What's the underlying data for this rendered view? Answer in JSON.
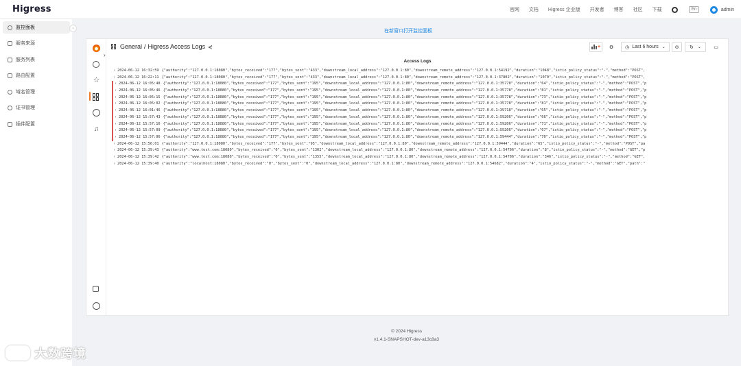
{
  "header": {
    "logo": "Higress",
    "nav": [
      "官网",
      "文档",
      "Higress 企业版",
      "开发者",
      "博客",
      "社区",
      "下载"
    ],
    "github_icon": "github-icon",
    "lang": "En",
    "user": "admin"
  },
  "sidebar": {
    "items": [
      {
        "label": "监控面板",
        "icon": "dashboard-icon"
      },
      {
        "label": "服务来源",
        "icon": "source-icon"
      },
      {
        "label": "服务列表",
        "icon": "list-icon"
      },
      {
        "label": "路由配置",
        "icon": "route-icon"
      },
      {
        "label": "域名管理",
        "icon": "globe-icon"
      },
      {
        "label": "证书管理",
        "icon": "certificate-icon"
      },
      {
        "label": "插件配置",
        "icon": "plugin-icon"
      }
    ]
  },
  "main": {
    "open_link": "在新窗口打开监控面板"
  },
  "dashboard": {
    "breadcrumb_root": "General",
    "breadcrumb_sep": "/",
    "title": "Higress Access Logs",
    "time_range": "Last 6 hours",
    "zoom_icon": "zoom-out-icon",
    "refresh_icon": "refresh-icon",
    "panel_title": "Access Logs"
  },
  "logs": [
    {
      "ts": "2024-06-12 16:32:59",
      "text": "{\"authority\":\"127.0.0.1:18080\",\"bytes_received\":\"177\",\"bytes_sent\":\"433\",\"downstream_local_address\":\"127.0.0.1:80\",\"downstream_remote_address\":\"127.0.0.1:54192\",\"duration\":\"1048\",\"istio_policy_status\":\"-\",\"method\":\"POST\",",
      "err": false
    },
    {
      "ts": "2024-06-12 16:22:11",
      "text": "{\"authority\":\"127.0.0.1:18080\",\"bytes_received\":\"177\",\"bytes_sent\":\"433\",\"downstream_local_address\":\"127.0.0.1:80\",\"downstream_remote_address\":\"127.0.0.1:37802\",\"duration\":\"1070\",\"istio_policy_status\":\"-\",\"method\":\"POST\",",
      "err": false
    },
    {
      "ts": "2024-06-12 16:05:48",
      "text": "{\"authority\":\"127.0.0.1:18080\",\"bytes_received\":\"177\",\"bytes_sent\":\"195\",\"downstream_local_address\":\"127.0.0.1:80\",\"downstream_remote_address\":\"127.0.0.1:35778\",\"duration\":\"64\",\"istio_policy_status\":\"-\",\"method\":\"POST\",\"p",
      "err": true
    },
    {
      "ts": "2024-06-12 16:05:46",
      "text": "{\"authority\":\"127.0.0.1:18080\",\"bytes_received\":\"177\",\"bytes_sent\":\"195\",\"downstream_local_address\":\"127.0.0.1:80\",\"downstream_remote_address\":\"127.0.0.1:35778\",\"duration\":\"81\",\"istio_policy_status\":\"-\",\"method\":\"POST\",\"p",
      "err": true
    },
    {
      "ts": "2024-06-12 16:05:15",
      "text": "{\"authority\":\"127.0.0.1:18080\",\"bytes_received\":\"177\",\"bytes_sent\":\"195\",\"downstream_local_address\":\"127.0.0.1:80\",\"downstream_remote_address\":\"127.0.0.1:35778\",\"duration\":\"73\",\"istio_policy_status\":\"-\",\"method\":\"POST\",\"p",
      "err": true
    },
    {
      "ts": "2024-06-12 16:05:02",
      "text": "{\"authority\":\"127.0.0.1:18080\",\"bytes_received\":\"177\",\"bytes_sent\":\"195\",\"downstream_local_address\":\"127.0.0.1:80\",\"downstream_remote_address\":\"127.0.0.1:35778\",\"duration\":\"81\",\"istio_policy_status\":\"-\",\"method\":\"POST\",\"p",
      "err": true
    },
    {
      "ts": "2024-06-12 16:01:46",
      "text": "{\"authority\":\"127.0.0.1:18080\",\"bytes_received\":\"177\",\"bytes_sent\":\"195\",\"downstream_local_address\":\"127.0.0.1:80\",\"downstream_remote_address\":\"127.0.0.1:39718\",\"duration\":\"65\",\"istio_policy_status\":\"-\",\"method\":\"POST\",\"p",
      "err": true
    },
    {
      "ts": "2024-06-12 15:57:43",
      "text": "{\"authority\":\"127.0.0.1:18080\",\"bytes_received\":\"177\",\"bytes_sent\":\"195\",\"downstream_local_address\":\"127.0.0.1:80\",\"downstream_remote_address\":\"127.0.0.1:59206\",\"duration\":\"66\",\"istio_policy_status\":\"-\",\"method\":\"POST\",\"p",
      "err": true
    },
    {
      "ts": "2024-06-12 15:57:16",
      "text": "{\"authority\":\"127.0.0.1:18080\",\"bytes_received\":\"177\",\"bytes_sent\":\"195\",\"downstream_local_address\":\"127.0.0.1:80\",\"downstream_remote_address\":\"127.0.0.1:59206\",\"duration\":\"71\",\"istio_policy_status\":\"-\",\"method\":\"POST\",\"p",
      "err": true
    },
    {
      "ts": "2024-06-12 15:57:09",
      "text": "{\"authority\":\"127.0.0.1:18080\",\"bytes_received\":\"177\",\"bytes_sent\":\"195\",\"downstream_local_address\":\"127.0.0.1:80\",\"downstream_remote_address\":\"127.0.0.1:59206\",\"duration\":\"67\",\"istio_policy_status\":\"-\",\"method\":\"POST\",\"p",
      "err": true
    },
    {
      "ts": "2024-06-12 15:57:06",
      "text": "{\"authority\":\"127.0.0.1:18080\",\"bytes_received\":\"177\",\"bytes_sent\":\"195\",\"downstream_local_address\":\"127.0.0.1:80\",\"downstream_remote_address\":\"127.0.0.1:59444\",\"duration\":\"70\",\"istio_policy_status\":\"-\",\"method\":\"POST\",\"p",
      "err": true
    },
    {
      "ts": "2024-06-12 15:56:01",
      "text": "{\"authority\":\"127.0.0.1:18080\",\"bytes_received\":\"177\",\"bytes_sent\":\"95\",\"downstream_local_address\":\"127.0.0.1:80\",\"downstream_remote_address\":\"127.0.0.1:59444\",\"duration\":\"65\",\"istio_policy_status\":\"-\",\"method\":\"POST\",\"pa",
      "err": false
    },
    {
      "ts": "2024-06-12 15:39:43",
      "text": "{\"authority\":\"www.test.com:18080\",\"bytes_received\":\"0\",\"bytes_sent\":\"1302\",\"downstream_local_address\":\"127.0.0.1:80\",\"downstream_remote_address\":\"127.0.0.1:54706\",\"duration\":\"8\",\"istio_policy_status\":\"-\",\"method\":\"GET\",\"p",
      "err": false
    },
    {
      "ts": "2024-06-12 15:39:42",
      "text": "{\"authority\":\"www.test.com:18080\",\"bytes_received\":\"0\",\"bytes_sent\":\"1355\",\"downstream_local_address\":\"127.0.0.1:80\",\"downstream_remote_address\":\"127.0.0.1:54706\",\"duration\":\"346\",\"istio_policy_status\":\"-\",\"method\":\"GET\",",
      "err": false
    },
    {
      "ts": "2024-06-12 15:39:40",
      "text": "{\"authority\":\"localhost:18080\",\"bytes_received\":\"0\",\"bytes_sent\":\"0\",\"downstream_local_address\":\"127.0.0.1:80\",\"downstream_remote_address\":\"127.0.0.1:54682\",\"duration\":\"4\",\"istio_policy_status\":\"-\",\"method\":\"GET\",\"path\":\"",
      "err": false
    }
  ],
  "footer": {
    "copyright": "© 2024 Higress",
    "version": "v1.4.1-SNAPSHOT-dev-a13c8a3"
  },
  "watermark": "大数跨境",
  "colors": {
    "accent": "#1e88e5",
    "grafana_orange": "#f07a2a",
    "error_bar": "#d9534f"
  }
}
